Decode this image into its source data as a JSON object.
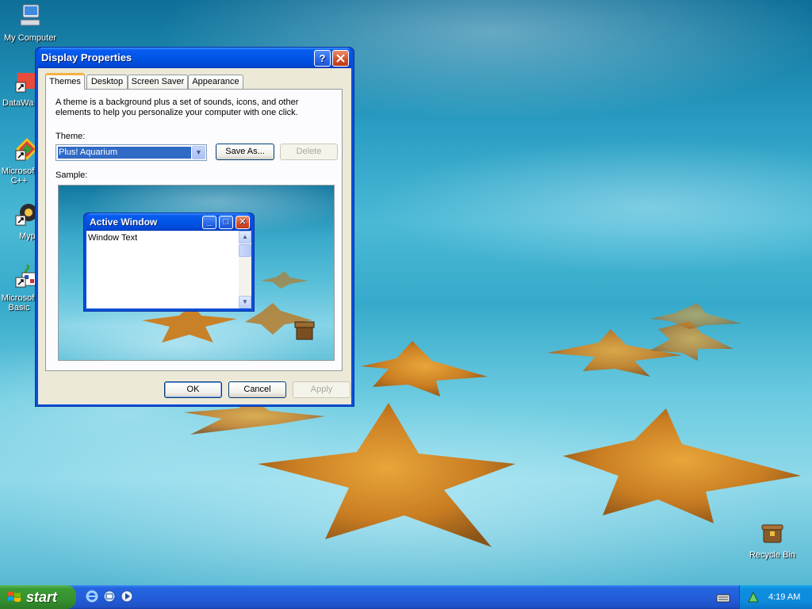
{
  "desktop": {
    "icons": [
      {
        "label": "My Computer",
        "icon": "my-computer-icon"
      },
      {
        "label": "DataWa",
        "icon": "shortcut-icon"
      },
      {
        "label": "Microsoft C++",
        "icon": "visual-cpp-icon"
      },
      {
        "label": "Myp",
        "icon": "shortcut-icon"
      },
      {
        "label": "Microsoft Basic",
        "icon": "visual-basic-icon"
      },
      {
        "label": "Recycle Bin",
        "icon": "recycle-bin-icon"
      }
    ]
  },
  "dialog": {
    "title": "Display Properties",
    "tabs": [
      "Themes",
      "Desktop",
      "Screen Saver",
      "Appearance"
    ],
    "active_tab": "Themes",
    "description": "A theme is a background plus a set of sounds, icons, and other elements to help you personalize your computer with one click.",
    "theme_label": "Theme:",
    "theme_value": "Plus! Aquarium",
    "save_as_label": "Save As...",
    "delete_label": "Delete",
    "sample_label": "Sample:",
    "sample_window_title": "Active Window",
    "sample_window_text": "Window Text",
    "ok_label": "OK",
    "cancel_label": "Cancel",
    "apply_label": "Apply"
  },
  "taskbar": {
    "start_label": "start",
    "clock": "4:19 AM"
  },
  "colors": {
    "titlebar": "#0055e6",
    "start_button": "#3a9b35",
    "taskbar": "#245edb",
    "selection": "#316ac5"
  }
}
